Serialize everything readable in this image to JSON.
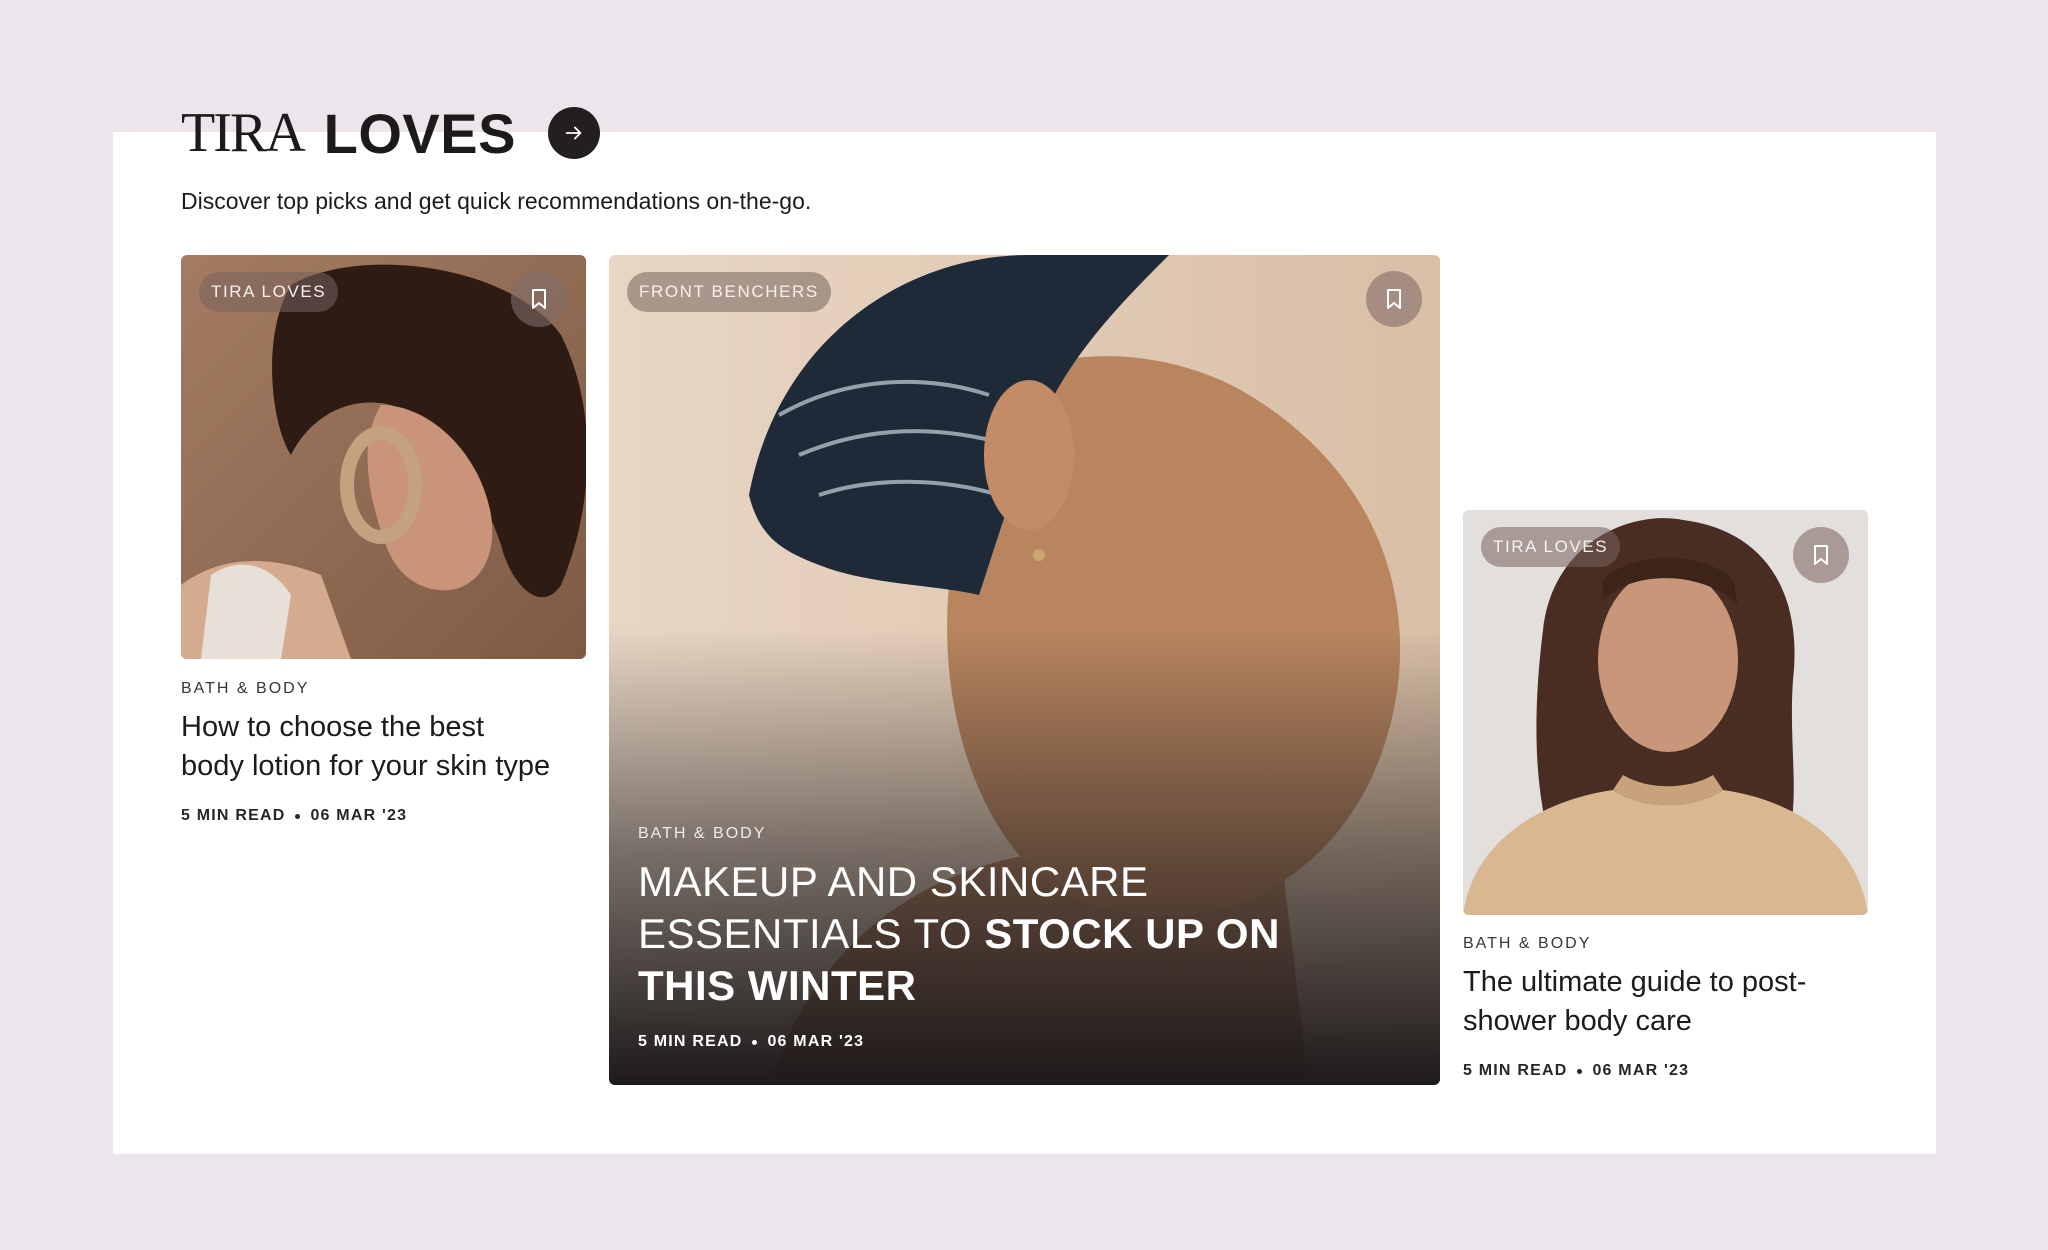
{
  "header": {
    "brand_light": "TIRA",
    "brand_bold": "LOVES",
    "subtitle": "Discover top picks and get quick recommendations on-the-go."
  },
  "cards": [
    {
      "badge": "TIRA LOVES",
      "category": "BATH & BODY",
      "title_line1": "How to choose the best",
      "title_line2": "body lotion for your skin type",
      "read_time": "5 MIN READ",
      "date": "06 MAR '23"
    },
    {
      "badge": "FRONT BENCHERS",
      "category": "BATH & BODY",
      "title_regular_1": "MAKEUP AND SKINCARE",
      "title_regular_2": "ESSENTIALS TO ",
      "title_bold_2": "STOCK UP ON",
      "title_bold_3": "THIS WINTER",
      "read_time": "5 MIN READ",
      "date": "06 MAR '23"
    },
    {
      "badge": "TIRA LOVES",
      "category": "BATH & BODY",
      "title_line1": "The ultimate guide to post-",
      "title_line2": "shower body care",
      "read_time": "5 MIN READ",
      "date": "06 MAR '23"
    }
  ],
  "colors": {
    "page_background": "#ede5ec",
    "panel": "#ffffff",
    "text": "#1d1a1b",
    "arrow_button": "#231f20"
  },
  "icons": {
    "header_button": "arrow-right-icon",
    "card_action": "bookmark-icon"
  }
}
